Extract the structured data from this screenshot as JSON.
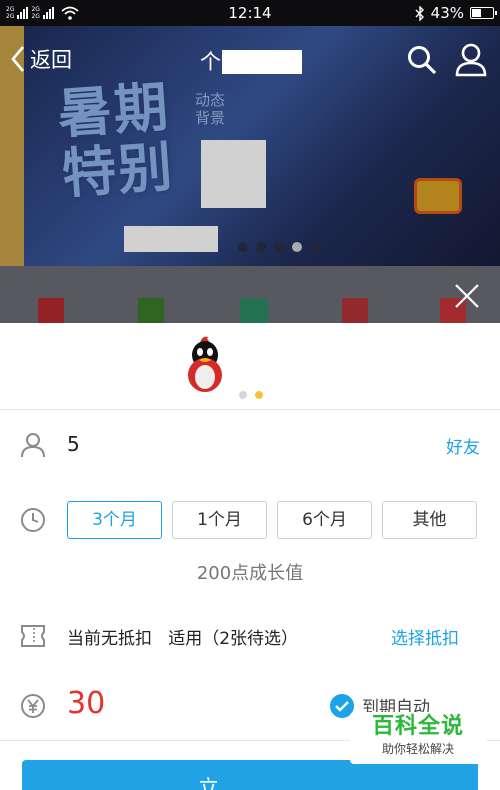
{
  "status_bar": {
    "network_top": "2G",
    "network_bottom": "2G",
    "time": "12:14",
    "battery": "43%",
    "battery_level": 0.43
  },
  "nav": {
    "back_label": "返回",
    "title": "个"
  },
  "banner": {
    "headline_line1": "暑期",
    "headline_line2": "特别",
    "subtitle_line1": "动态",
    "subtitle_line2": "背景"
  },
  "account": {
    "value": "5",
    "friends_link": "好友"
  },
  "duration": {
    "options": [
      "3个月",
      "1个月",
      "6个月",
      "其他"
    ],
    "selected_index": 0
  },
  "growth_text": "200点成长值",
  "discount": {
    "status": "当前无抵扣",
    "applicable": "适用（2张待选）",
    "link": "选择抵扣"
  },
  "price": {
    "amount": "30",
    "auto_renew": "到期自动"
  },
  "pay_button": {
    "label": "立"
  },
  "watermark": {
    "title": "百科全说",
    "subtitle": "助你轻松解决"
  },
  "colors": {
    "accent": "#1aa3e8",
    "price": "#e5322d",
    "pager_active": "#f4c431"
  }
}
